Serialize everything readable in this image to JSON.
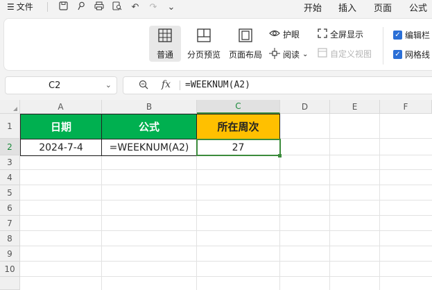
{
  "menubar": {
    "file_label": "文件",
    "tabs": [
      "开始",
      "插入",
      "页面",
      "公式"
    ]
  },
  "ribbon": {
    "normal_label": "普通",
    "page_break_label": "分页预览",
    "page_layout_label": "页面布局",
    "eye_protection_label": "护眼",
    "read_label": "阅读",
    "fullscreen_label": "全屏显示",
    "custom_view_label": "自定义视图",
    "edit_bar_label": "编辑栏",
    "gridlines_label": "网格线"
  },
  "formula_bar": {
    "name_box": "C2",
    "fx_label": "fx",
    "formula": "=WEEKNUM(A2)"
  },
  "sheet": {
    "columns": [
      "A",
      "B",
      "C",
      "D",
      "E",
      "F"
    ],
    "rows": [
      "1",
      "2",
      "3",
      "4",
      "5",
      "6",
      "7",
      "8",
      "9",
      "10"
    ],
    "header_cells": [
      "日期",
      "公式",
      "所在周次"
    ],
    "data_cells": [
      "2024-7-4",
      "=WEEKNUM(A2)",
      "27"
    ],
    "colors": {
      "green_header": "#00b050",
      "yellow_header": "#ffc000",
      "selection": "#3b8b3b"
    }
  }
}
